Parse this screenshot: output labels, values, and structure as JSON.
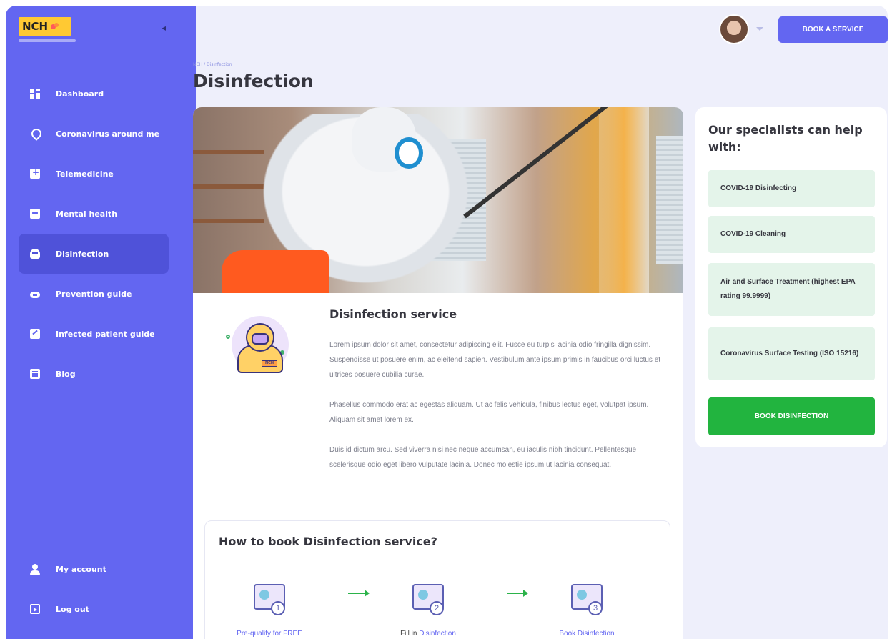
{
  "sidebar": {
    "logo": "NCH",
    "collapse_icon": "chevron-left-icon",
    "items": [
      {
        "label": "Dashboard",
        "icon": "dashboard-icon"
      },
      {
        "label": "Coronavirus around me",
        "icon": "map-pin-icon"
      },
      {
        "label": "Telemedicine",
        "icon": "telemedicine-icon"
      },
      {
        "label": "Mental health",
        "icon": "monitor-icon"
      },
      {
        "label": "Disinfection",
        "icon": "hazmat-icon",
        "active": true
      },
      {
        "label": "Prevention guide",
        "icon": "mask-icon"
      },
      {
        "label": "Infected patient guide",
        "icon": "clipboard-icon"
      },
      {
        "label": "Blog",
        "icon": "document-icon"
      }
    ],
    "bottom": [
      {
        "label": "My account",
        "icon": "user-icon"
      },
      {
        "label": "Log out",
        "icon": "logout-icon"
      }
    ]
  },
  "header": {
    "book_service_label": "BOOK A SERVICE"
  },
  "breadcrumb": "NCH / Disinfection",
  "page_title": "Disinfection",
  "service": {
    "title": "Disinfection service",
    "paragraphs": [
      "Lorem ipsum dolor sit amet, consectetur adipiscing elit. Fusce eu turpis lacinia odio fringilla dignissim. Suspendisse ut posuere enim, ac eleifend sapien. Vestibulum ante ipsum primis in faucibus orci luctus et ultrices posuere cubilia curae.",
      "Phasellus commodo erat ac egestas aliquam. Ut ac felis vehicula, finibus lectus eget, volutpat ipsum. Aliquam sit amet lorem ex.",
      "Duis id dictum arcu. Sed viverra nisi nec neque accumsan, eu iaculis nibh tincidunt. Pellentesque scelerisque odio eget libero vulputate lacinia. Donec molestie ipsum ut lacinia consequat."
    ],
    "illustration_badge": "NCH"
  },
  "howto": {
    "title": "How to book Disinfection service?",
    "steps": [
      {
        "number": "1",
        "label": "Pre-qualify for FREE"
      },
      {
        "number": "2",
        "label_prefix": "Fill in ",
        "label_link": "Disinfection"
      },
      {
        "number": "3",
        "label": "Book Disinfection"
      }
    ]
  },
  "specialists": {
    "title": "Our specialists can help with:",
    "items": [
      "COVID-19 Disinfecting",
      "COVID-19 Cleaning",
      "Air and Surface Treatment (highest EPA rating 99.9999)",
      "Coronavirus Surface Testing (ISO 15216)"
    ],
    "cta_label": "BOOK DISINFECTION"
  },
  "colors": {
    "sidebar": "#6366f1",
    "active_nav": "#4f52d9",
    "cta_green": "#22b43f",
    "background": "#eeeffb"
  }
}
